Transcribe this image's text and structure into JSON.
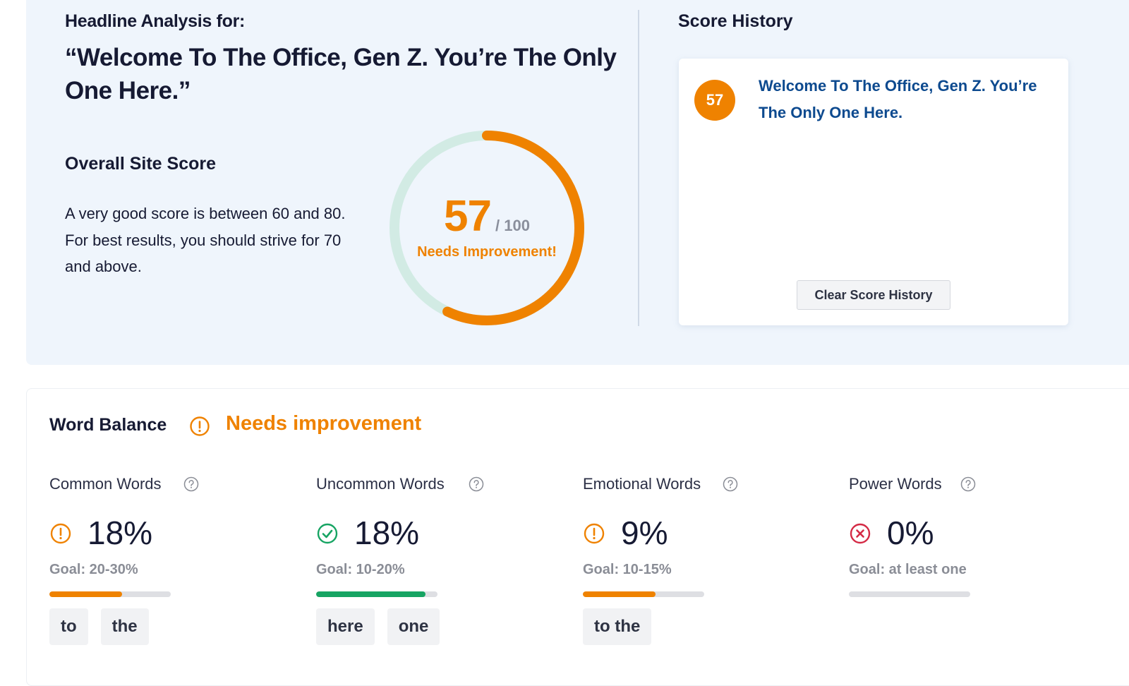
{
  "header": {
    "label": "Headline Analysis for:",
    "headline": "“Welcome To The Office, Gen Z. You’re The Only One Here.”"
  },
  "overall": {
    "title": "Overall Site Score",
    "description": "A very good score is between 60 and 80. For best results, you should strive for 70 and above.",
    "score": "57",
    "score_value": 57,
    "max": "/ 100",
    "max_value": 100,
    "status": "Needs Improvement!",
    "colors": {
      "progress": "#ef8200",
      "track": "#d2ebe4"
    }
  },
  "history": {
    "title": "Score History",
    "items": [
      {
        "score": "57",
        "text": "Welcome To The Office, Gen Z. You’re The Only One Here."
      }
    ],
    "clear_label": "Clear Score History"
  },
  "word_balance": {
    "title": "Word Balance",
    "status_icon": "warning-icon",
    "status": "Needs improvement",
    "metrics": [
      {
        "label": "Common Words",
        "help_icon": "question-icon",
        "status_icon": "warning-icon",
        "value": "18%",
        "goal": "Goal: 20-30%",
        "progress": 0.6,
        "color": "#ef8200",
        "chips": [
          "to",
          "the"
        ]
      },
      {
        "label": "Uncommon Words",
        "help_icon": "question-icon",
        "status_icon": "check-icon",
        "value": "18%",
        "goal": "Goal: 10-20%",
        "progress": 0.9,
        "color": "#17a463",
        "chips": [
          "here",
          "one"
        ]
      },
      {
        "label": "Emotional Words",
        "help_icon": "question-icon",
        "status_icon": "warning-icon",
        "value": "9%",
        "goal": "Goal: 10-15%",
        "progress": 0.6,
        "color": "#ef8200",
        "chips": [
          "to the"
        ]
      },
      {
        "label": "Power Words",
        "help_icon": "question-icon",
        "status_icon": "error-icon",
        "value": "0%",
        "goal": "Goal: at least one",
        "progress": 0,
        "color": "#d42a45",
        "chips": []
      }
    ]
  }
}
